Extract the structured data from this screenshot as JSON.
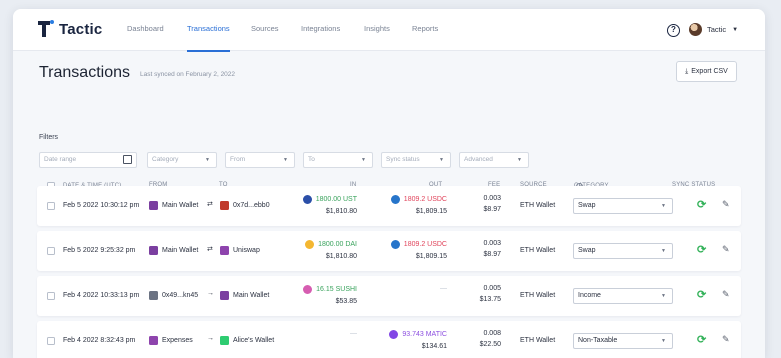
{
  "brand": {
    "name": "Tactic"
  },
  "nav": {
    "items": [
      {
        "label": "Dashboard",
        "active": false
      },
      {
        "label": "Transactions",
        "active": true
      },
      {
        "label": "Sources",
        "active": false
      },
      {
        "label": "Integrations",
        "active": false
      },
      {
        "label": "Insights",
        "active": false
      },
      {
        "label": "Reports",
        "active": false
      }
    ]
  },
  "user": {
    "name": "Tactic",
    "help": "?"
  },
  "page": {
    "title": "Transactions",
    "synced": "Last synced on February 2, 2022",
    "export_label": "Export CSV"
  },
  "filters": {
    "label": "Filters",
    "date_placeholder": "Date range",
    "category_placeholder": "Category",
    "from_placeholder": "From",
    "to_placeholder": "To",
    "sync_status_placeholder": "Sync status",
    "advanced_label": "Advanced"
  },
  "table": {
    "headers": {
      "date": "Date & time (UTC)",
      "sort_arrow": "↑",
      "from": "From",
      "to": "To",
      "in": "In",
      "out": "Out",
      "fee": "Fee",
      "source": "Source",
      "category": "Category",
      "sync_status": "Sync status"
    },
    "rows": [
      {
        "date": "Feb 5 2022 10:30:12 pm",
        "from": "Main Wallet",
        "from_color": "#7b3fa0",
        "to": "0x7d...ebb0",
        "to_color": "#c0392b",
        "arrow": "⇄",
        "in_amount": "1800.00 UST",
        "in_usd": "$1,810.80",
        "in_coin": "#2b4fa8",
        "out_amount": "1809.2 USDC",
        "out_usd": "$1,809.15",
        "out_coin": "#2775ca",
        "fee": "0.003",
        "fee_usd": "$8.97",
        "source": "ETH Wallet",
        "category": "Swap"
      },
      {
        "date": "Feb 5 2022 9:25:32 pm",
        "from": "Main Wallet",
        "from_color": "#7b3fa0",
        "to": "Uniswap",
        "to_color": "#8e44ad",
        "arrow": "⇄",
        "in_amount": "1800.00 DAI",
        "in_usd": "$1,810.80",
        "in_coin": "#f4b731",
        "out_amount": "1809.2 USDC",
        "out_usd": "$1,809.15",
        "out_coin": "#2775ca",
        "fee": "0.003",
        "fee_usd": "$8.97",
        "source": "ETH Wallet",
        "category": "Swap"
      },
      {
        "date": "Feb 4 2022 10:33:13 pm",
        "from": "0x49...kn45",
        "from_color": "#6b7383",
        "to": "Main Wallet",
        "to_color": "#7b3fa0",
        "arrow": "→",
        "in_amount": "16.15 SUSHI",
        "in_usd": "$53.85",
        "in_coin": "#d65db1",
        "out_amount": "—",
        "out_usd": "",
        "out_coin": "",
        "fee": "0.005",
        "fee_usd": "$13.75",
        "source": "ETH Wallet",
        "category": "Income"
      },
      {
        "date": "Feb 4 2022 8:32:43 pm",
        "from": "Expenses",
        "from_color": "#8e44ad",
        "to": "Alice's Wallet",
        "to_color": "#2ecc71",
        "arrow": "→",
        "in_amount": "—",
        "in_usd": "",
        "in_coin": "",
        "out_amount": "93.743 MATIC",
        "out_usd": "$134.61",
        "out_coin": "#8247e5",
        "fee": "0.008",
        "fee_usd": "$22.50",
        "source": "ETH Wallet",
        "category": "Non-Taxable"
      }
    ]
  },
  "colors": {
    "accent": "#2a6fd6",
    "in": "#3aa35d",
    "out": "#e0445b",
    "sync": "#34b25a"
  }
}
